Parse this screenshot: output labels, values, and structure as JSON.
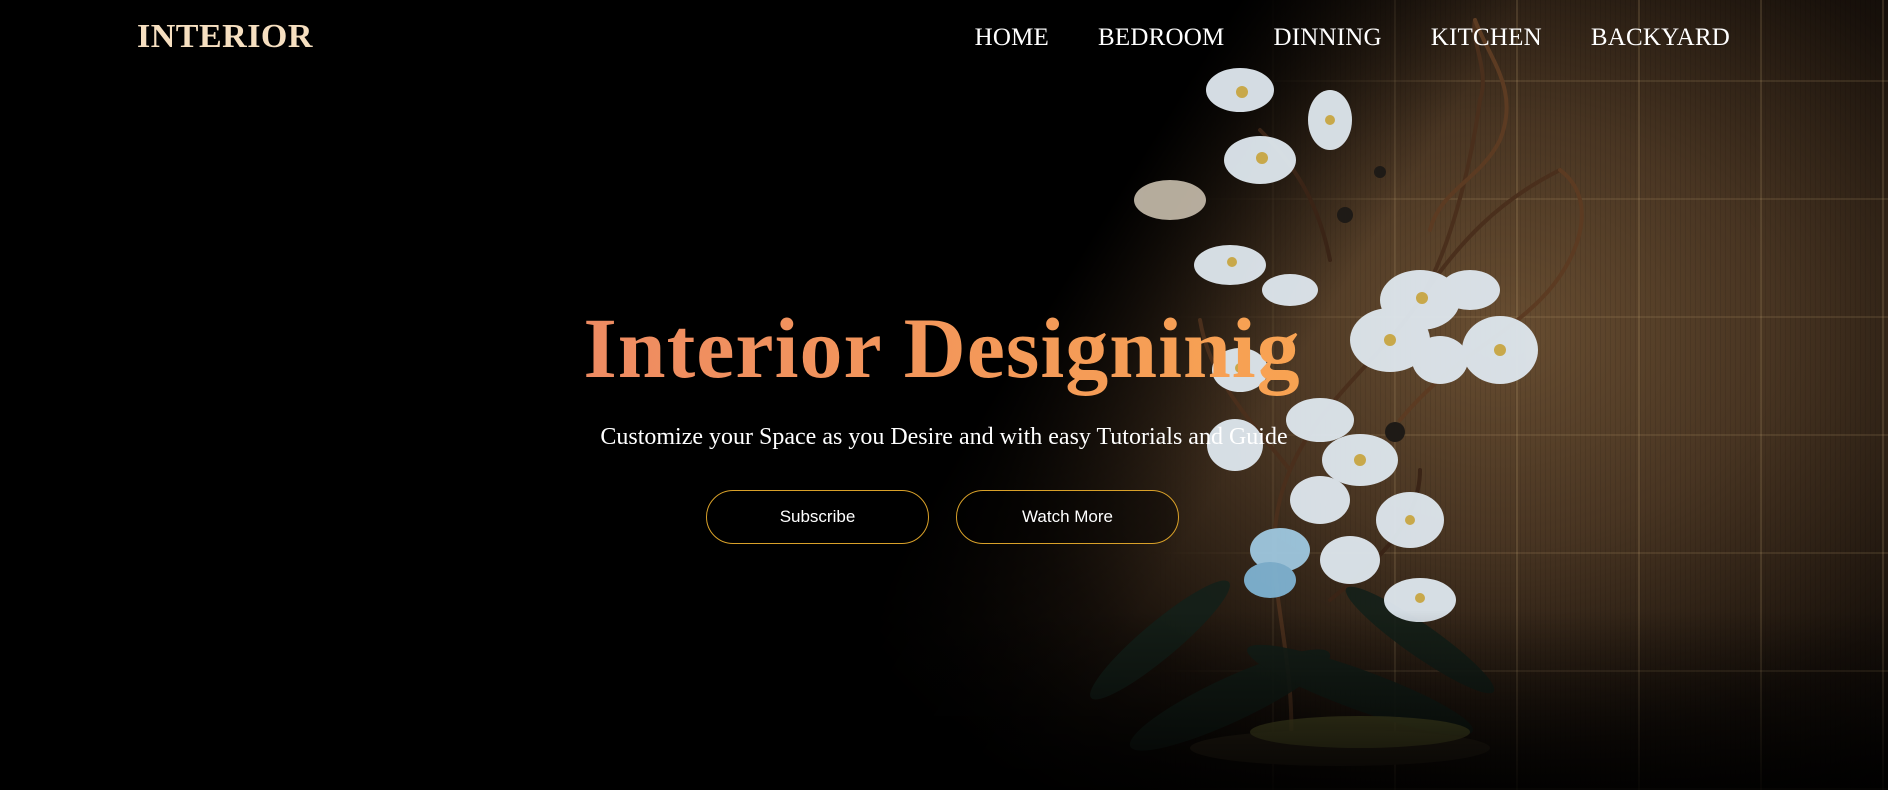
{
  "brand": {
    "logo_text": "INTERIOR",
    "logo_color": "#f6dfc0"
  },
  "nav": {
    "items": [
      {
        "label": "HOME"
      },
      {
        "label": "BEDROOM"
      },
      {
        "label": "DINNING"
      },
      {
        "label": "KITCHEN"
      },
      {
        "label": "BACKYARD"
      }
    ]
  },
  "hero": {
    "title": "Interior Designinig",
    "subtitle": "Customize your Space as you Desire and with easy Tutorials and Guide",
    "title_gradient": [
      "#ee8b62",
      "#f8a352"
    ],
    "buttons": [
      {
        "label": "Subscribe"
      },
      {
        "label": "Watch More"
      }
    ],
    "button_border_color": "#d9a129"
  },
  "background": {
    "subject": "white orchid against a gilded tiled wall with diagonal shadow"
  }
}
